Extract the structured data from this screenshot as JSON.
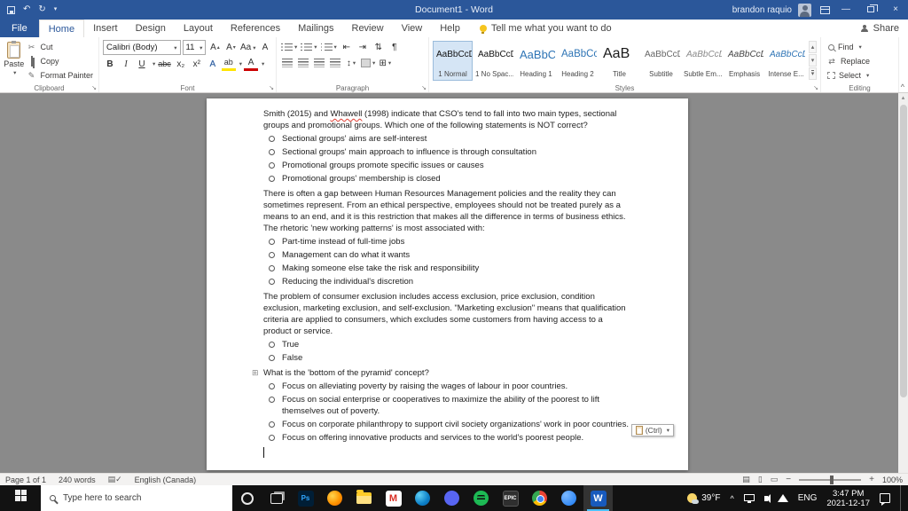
{
  "titlebar": {
    "title": "Document1 - Word",
    "user": "brandon raquio"
  },
  "tabs": {
    "file": "File",
    "items": [
      "Home",
      "Insert",
      "Design",
      "Layout",
      "References",
      "Mailings",
      "Review",
      "View",
      "Help"
    ],
    "tell_me": "Tell me what you want to do",
    "share": "Share"
  },
  "icons": {
    "dropdown": "▾",
    "launcher": "↘",
    "undo": "↶",
    "redo": "↻",
    "scissors": "✂",
    "brush": "✎",
    "pilcrow": "¶",
    "sort": "⇅",
    "indent_decrease": "⇤",
    "indent_increase": "⇥",
    "spacing_arrows": "↕",
    "borders": "⊞",
    "anchor": "⊞",
    "grow_arrow": "▴",
    "shrink_arrow": "▾",
    "scroll_up": "▴",
    "scroll_down": "▾",
    "close": "×",
    "minimize": "—",
    "collapse": "^",
    "chevron_up": "^",
    "book": "▤",
    "check": "✓",
    "view_read": "▤",
    "view_print": "▯",
    "view_web": "▭",
    "zoom_out": "−",
    "zoom_in": "+",
    "replace_arrows": "⇄"
  },
  "ribbon": {
    "clipboard": {
      "label": "Clipboard",
      "paste": "Paste",
      "cut": "Cut",
      "copy": "Copy",
      "format_painter": "Format Painter"
    },
    "font": {
      "label": "Font",
      "name": "Calibri (Body)",
      "size": "11",
      "bold": "B",
      "italic": "I",
      "underline": "U",
      "strikethrough": "abc",
      "subscript": "x₂",
      "superscript": "x²",
      "grow": "A",
      "shrink": "A",
      "change_case": "Aa",
      "clear": "A",
      "effects": "A",
      "highlight": "ab",
      "color": "A"
    },
    "paragraph": {
      "label": "Paragraph"
    },
    "styles": {
      "label": "Styles",
      "items": [
        {
          "preview": "AaBbCcDd",
          "name": "1 Normal",
          "cls": "st-normal"
        },
        {
          "preview": "AaBbCcDd",
          "name": "1 No Spac...",
          "cls": "st-normal"
        },
        {
          "preview": "AaBbCc",
          "name": "Heading 1",
          "cls": "st-h1"
        },
        {
          "preview": "AaBbCcD",
          "name": "Heading 2",
          "cls": "st-h2"
        },
        {
          "preview": "AaB",
          "name": "Title",
          "cls": "st-title"
        },
        {
          "preview": "AaBbCcD",
          "name": "Subtitle",
          "cls": "st-subtitle"
        },
        {
          "preview": "AaBbCcDd",
          "name": "Subtle Em...",
          "cls": "st-subtle"
        },
        {
          "preview": "AaBbCcDd",
          "name": "Emphasis",
          "cls": "st-emph"
        },
        {
          "preview": "AaBbCcDd",
          "name": "Intense E...",
          "cls": "st-intense"
        }
      ]
    },
    "editing": {
      "label": "Editing",
      "find": "Find",
      "replace": "Replace",
      "select": "Select"
    }
  },
  "document": {
    "questions": [
      {
        "text": "Smith (2015) and Whawell (1998) indicate that CSO's tend to fall into two main types, sectional groups and promotional groups. Which one of the following statements is NOT correct?",
        "misspelled": "Whawell",
        "options": [
          "Sectional groups' aims are self-interest",
          "Sectional groups' main approach to influence is through consultation",
          "Promotional groups promote specific issues or causes",
          "Promotional groups' membership is closed"
        ]
      },
      {
        "text": "There is often a gap between Human Resources Management policies and the reality they can sometimes represent. From an ethical perspective, employees should not be treated purely as a means to an end, and it is this restriction that makes all the difference in terms of business ethics. The rhetoric 'new working patterns' is most associated with:",
        "options": [
          "Part-time instead of full-time jobs",
          "Management can do what it wants",
          "Making someone else take the risk and responsibility",
          "Reducing the individual's discretion"
        ]
      },
      {
        "text": "The problem of consumer exclusion includes access exclusion, price exclusion, condition exclusion, marketing exclusion, and self-exclusion. \"Marketing exclusion\" means that qualification criteria are applied to consumers, which excludes some customers from having access to a product or service.",
        "options": [
          "True",
          "False"
        ]
      },
      {
        "text": "What is the 'bottom of the pyramid' concept?",
        "anchor": true,
        "options": [
          "Focus on alleviating poverty by raising the wages of labour in poor countries.",
          "Focus on social enterprise or cooperatives to maximize the ability of the poorest to lift themselves out of poverty.",
          "Focus on corporate philanthropy to support civil society organizations' work in poor countries.",
          "Focus on offering innovative products and services to the world's poorest people."
        ]
      }
    ],
    "paste_chip": "(Ctrl)"
  },
  "statusbar": {
    "page": "Page 1 of 1",
    "words": "240 words",
    "language": "English (Canada)",
    "zoom": "100%"
  },
  "taskbar": {
    "search_placeholder": "Type here to search",
    "icons": [
      {
        "id": "cortana"
      },
      {
        "id": "task-view"
      },
      {
        "id": "photoshop",
        "glyph": "Ps"
      },
      {
        "id": "firefox"
      },
      {
        "id": "file-explorer"
      },
      {
        "id": "gmail",
        "glyph": "M"
      },
      {
        "id": "edge"
      },
      {
        "id": "discord"
      },
      {
        "id": "spotify"
      },
      {
        "id": "epic-games",
        "glyph": "EPIC"
      },
      {
        "id": "chrome"
      },
      {
        "id": "messenger"
      },
      {
        "id": "word",
        "glyph": "W",
        "active": true
      }
    ],
    "tray": {
      "temp": "39°F",
      "lang": "ENG",
      "time": "3:47 PM",
      "date": "2021-12-17"
    }
  }
}
